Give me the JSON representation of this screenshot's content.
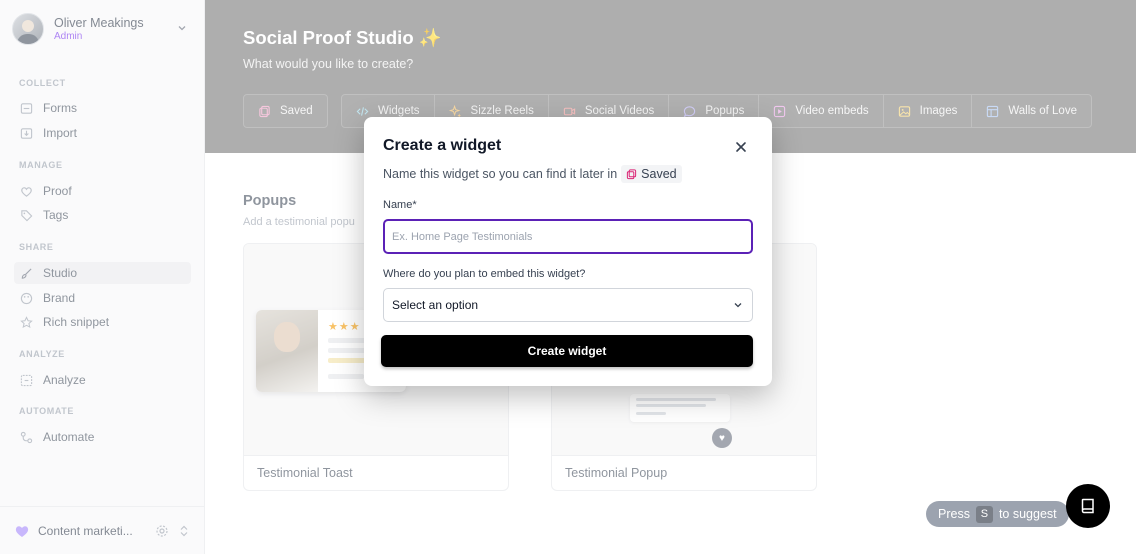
{
  "user": {
    "name": "Oliver Meakings",
    "role": "Admin"
  },
  "sidebar": {
    "sections": [
      {
        "label": "COLLECT",
        "items": [
          {
            "label": "Forms",
            "icon": "forms-icon"
          },
          {
            "label": "Import",
            "icon": "import-icon"
          }
        ]
      },
      {
        "label": "MANAGE",
        "items": [
          {
            "label": "Proof",
            "icon": "heart-icon"
          },
          {
            "label": "Tags",
            "icon": "tag-icon"
          }
        ]
      },
      {
        "label": "SHARE",
        "items": [
          {
            "label": "Studio",
            "icon": "brush-icon",
            "active": true
          },
          {
            "label": "Brand",
            "icon": "palette-icon"
          },
          {
            "label": "Rich snippet",
            "icon": "star-icon"
          }
        ]
      },
      {
        "label": "ANALYZE",
        "items": [
          {
            "label": "Analyze",
            "icon": "analyze-icon"
          }
        ]
      },
      {
        "label": "AUTOMATE",
        "items": [
          {
            "label": "Automate",
            "icon": "automate-icon"
          }
        ]
      }
    ],
    "footer": {
      "label": "Content marketi..."
    }
  },
  "hero": {
    "title": "Social Proof Studio ✨",
    "subtitle": "What would you like to create?",
    "tabs": [
      "Saved",
      "Widgets",
      "Sizzle Reels",
      "Social Videos",
      "Popups",
      "Video embeds",
      "Images",
      "Walls of Love"
    ]
  },
  "content": {
    "section_title": "Popups",
    "section_desc": "Add a testimonial popu",
    "cards": [
      {
        "label": "Testimonial Toast"
      },
      {
        "label": "Testimonial Popup"
      }
    ],
    "toast_stars": "★★★"
  },
  "modal": {
    "title": "Create a widget",
    "subtitle": "Name this widget so you can find it later in",
    "saved_chip": "Saved",
    "name_label": "Name*",
    "name_placeholder": "Ex. Home Page Testimonials",
    "embed_label": "Where do you plan to embed this widget?",
    "select_value": "Select an option",
    "submit": "Create widget"
  },
  "suggest": {
    "prefix": "Press",
    "key": "S",
    "suffix": "to suggest"
  },
  "colors": {
    "accent": "#7c3aed",
    "focus_border": "#5b21b6",
    "button": "#000000"
  }
}
